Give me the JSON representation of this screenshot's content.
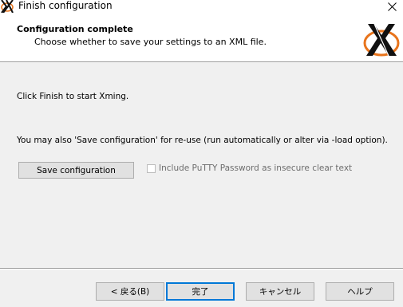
{
  "window": {
    "title": "Finish configuration",
    "close_glyph": "✕"
  },
  "header": {
    "title": "Configuration complete",
    "subtitle": "Choose whether to save your settings to an XML file."
  },
  "content": {
    "finish_text": "Click Finish to start Xming.",
    "save_text": "You may also 'Save configuration' for re-use (run automatically or alter via -load option).",
    "save_button_label": "Save configuration",
    "checkbox_label": "Include PuTTY Password as insecure clear text",
    "checkbox_checked": false
  },
  "footer": {
    "back_label": "< 戻る(B)",
    "finish_label": "完了",
    "cancel_label": "キャンセル",
    "help_label": "ヘルプ"
  },
  "icons": {
    "app": "xming-icon",
    "logo": "xming-logo"
  },
  "colors": {
    "accent": "#0078d7",
    "logo_orange": "#e8741c"
  }
}
